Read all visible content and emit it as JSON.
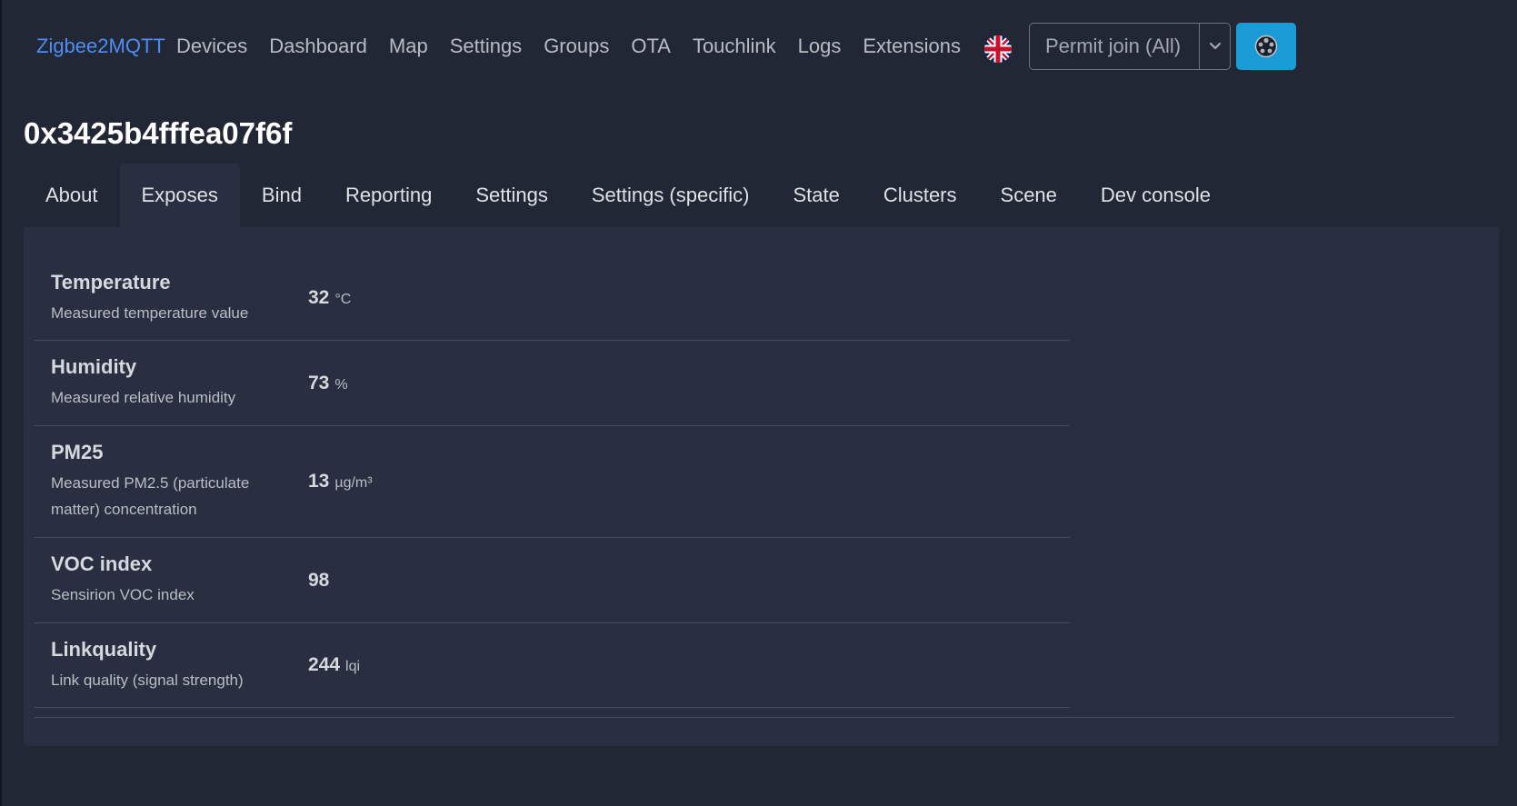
{
  "navbar": {
    "brand": "Zigbee2MQTT",
    "links": [
      "Devices",
      "Dashboard",
      "Map",
      "Settings",
      "Groups",
      "OTA",
      "Touchlink",
      "Logs",
      "Extensions"
    ],
    "language_icon": "uk-flag-icon",
    "permit_join_label": "Permit join (All)",
    "theme_icon": "theme-toggle-icon"
  },
  "device": {
    "title": "0x3425b4fffea07f6f"
  },
  "tabs": [
    {
      "label": "About",
      "active": false
    },
    {
      "label": "Exposes",
      "active": true
    },
    {
      "label": "Bind",
      "active": false
    },
    {
      "label": "Reporting",
      "active": false
    },
    {
      "label": "Settings",
      "active": false
    },
    {
      "label": "Settings (specific)",
      "active": false
    },
    {
      "label": "State",
      "active": false
    },
    {
      "label": "Clusters",
      "active": false
    },
    {
      "label": "Scene",
      "active": false
    },
    {
      "label": "Dev console",
      "active": false
    }
  ],
  "exposes": [
    {
      "name": "Temperature",
      "description": "Measured temperature value",
      "value": "32",
      "unit": "°C"
    },
    {
      "name": "Humidity",
      "description": "Measured relative humidity",
      "value": "73",
      "unit": "%"
    },
    {
      "name": "PM25",
      "description": "Measured PM2.5 (particulate matter) concentration",
      "value": "13",
      "unit": "µg/m³"
    },
    {
      "name": "VOC index",
      "description": "Sensirion VOC index",
      "value": "98",
      "unit": ""
    },
    {
      "name": "Linkquality",
      "description": "Link quality (signal strength)",
      "value": "244",
      "unit": "lqi"
    }
  ],
  "colors": {
    "background": "#222736",
    "panel": "#292f40",
    "brand": "#4f8ef0",
    "accent_button": "#1a9bd6"
  }
}
